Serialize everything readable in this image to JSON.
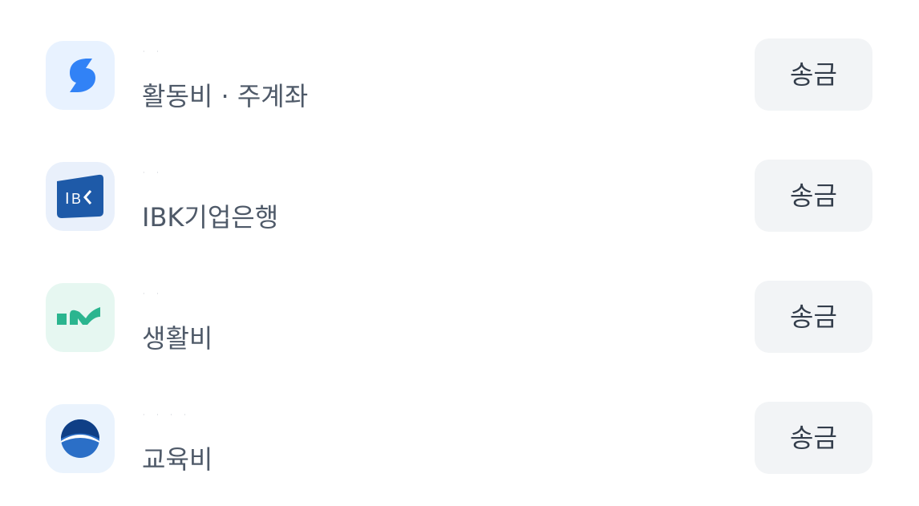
{
  "accounts": [
    {
      "icon": "toss-bank-logo-icon",
      "account_number": "· ·",
      "label": "활동비 · 주계좌",
      "button_label": "송금"
    },
    {
      "icon": "ibk-bank-logo-icon",
      "account_number": "· ·",
      "label": "IBK기업은행",
      "button_label": "송금"
    },
    {
      "icon": "kbank-logo-icon",
      "account_number": "· ·",
      "label": "생활비",
      "button_label": "송금"
    },
    {
      "icon": "kakao-style-bank-logo-icon",
      "account_number": "· · · ·",
      "label": "교육비",
      "button_label": "송금"
    }
  ],
  "colors": {
    "label_text": "#4e5968",
    "button_bg": "#f2f4f6",
    "button_text": "#333d4b",
    "toss_blue": "#3182f6",
    "ibk_blue": "#1e5aa8",
    "kbank_green": "#2bb58f"
  }
}
